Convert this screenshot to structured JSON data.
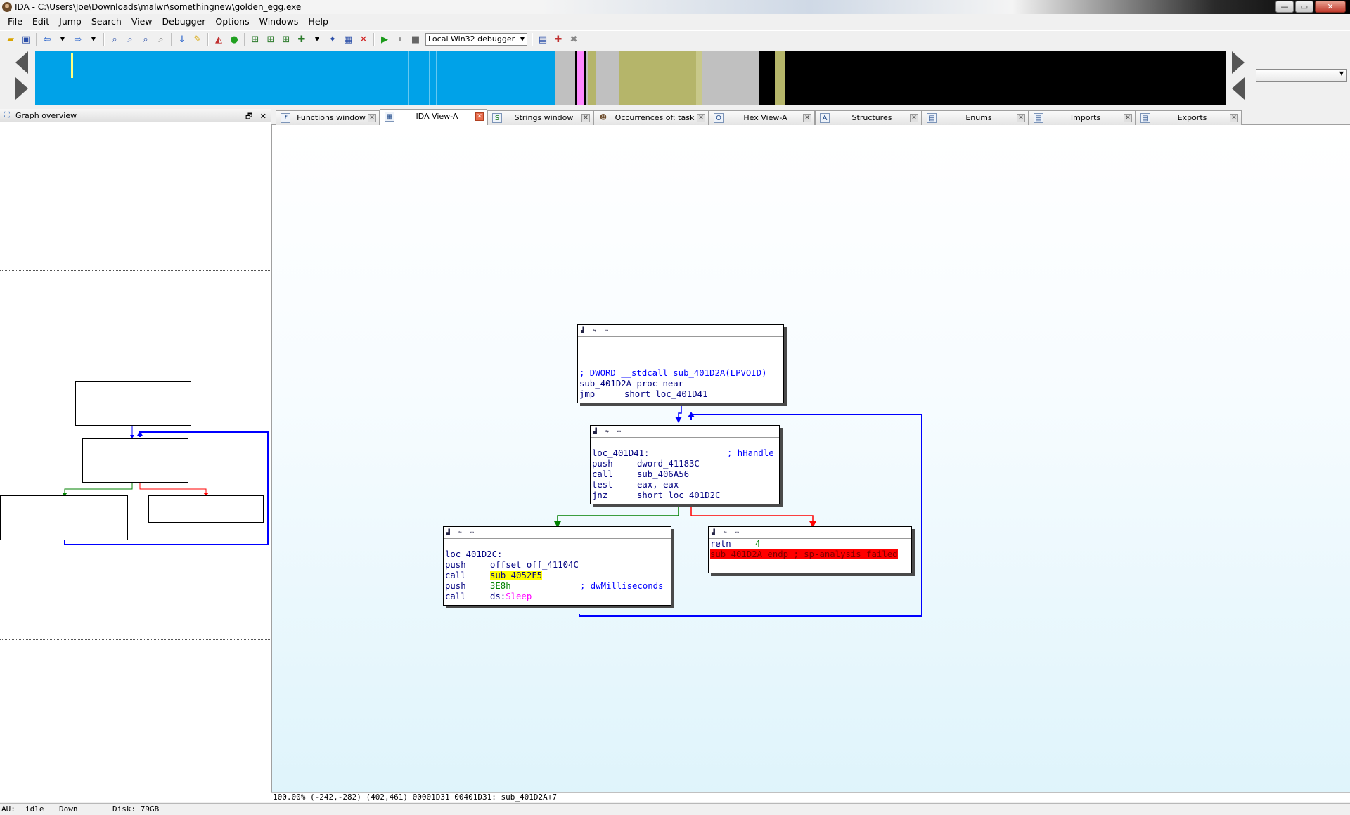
{
  "window": {
    "title": "IDA - C:\\Users\\Joe\\Downloads\\malwr\\somethingnew\\golden_egg.exe",
    "minimize": "—",
    "maximize": "▭",
    "close": "✕"
  },
  "menu": [
    "File",
    "Edit",
    "Jump",
    "Search",
    "View",
    "Debugger",
    "Options",
    "Windows",
    "Help"
  ],
  "toolbar": {
    "debugger_select": "Local Win32 debugger"
  },
  "colors": {
    "nav_code": "#00a2e8",
    "nav_data": "#c0c0c0",
    "nav_olive": "#b5b56a",
    "nav_unexplored": "#000000",
    "nav_pink": "#ff88ff",
    "edge_normal": "#0000ff",
    "edge_true": "#008000",
    "edge_false": "#ff0000"
  },
  "graph_overview": {
    "title": "Graph overview",
    "restore_btn": "🗗",
    "close_btn": "✕"
  },
  "tabs": [
    {
      "label": "Functions window",
      "icon": "f",
      "active": false
    },
    {
      "label": "IDA View-A",
      "icon": "▦",
      "active": true
    },
    {
      "label": "Strings window",
      "icon": "S",
      "active": false
    },
    {
      "label": "Occurrences of: task",
      "icon": "☻",
      "active": false
    },
    {
      "label": "Hex View-A",
      "icon": "O",
      "active": false
    },
    {
      "label": "Structures",
      "icon": "A",
      "active": false
    },
    {
      "label": "Enums",
      "icon": "▤",
      "active": false
    },
    {
      "label": "Imports",
      "icon": "▤",
      "active": false
    },
    {
      "label": "Exports",
      "icon": "▤",
      "active": false
    }
  ],
  "nodes": {
    "n1": {
      "proto_cmt": "; DWORD __stdcall sub_401D2A(LPVOID)",
      "proc_name": "sub_401D2A",
      "proc_kw": "proc near",
      "jmp_mn": "jmp",
      "jmp_op": "short loc_401D41"
    },
    "n2": {
      "label": "loc_401D41:",
      "label_cmt": "; hHandle",
      "l1_mn": "push",
      "l1_op": "dword_41183C",
      "l2_mn": "call",
      "l2_op": "sub_406A56",
      "l3_mn": "test",
      "l3_op": "eax, eax",
      "l4_mn": "jnz",
      "l4_op": "short loc_401D2C"
    },
    "n3": {
      "label": "loc_401D2C:",
      "l1_mn": "push",
      "l1_op": "offset off_41104C",
      "l2_mn": "call",
      "l2_op": "sub_4052F5",
      "l3_mn": "push",
      "l3_op": "3E8h",
      "l3_cmt": "; dwMilliseconds",
      "l4_mn": "call",
      "l4_seg": "ds:",
      "l4_op": "Sleep"
    },
    "n4": {
      "l1_mn": "retn",
      "l1_op": "4",
      "l2_err": "sub_401D2A endp ; sp-analysis failed"
    }
  },
  "graph_status": "100.00% (-242,-282) (402,461) 00001D31 00401D31: sub_401D2A+7",
  "statusbar": {
    "au_label": "AU:",
    "au_state": "idle",
    "direction": "Down",
    "disk": "Disk: 79GB"
  }
}
